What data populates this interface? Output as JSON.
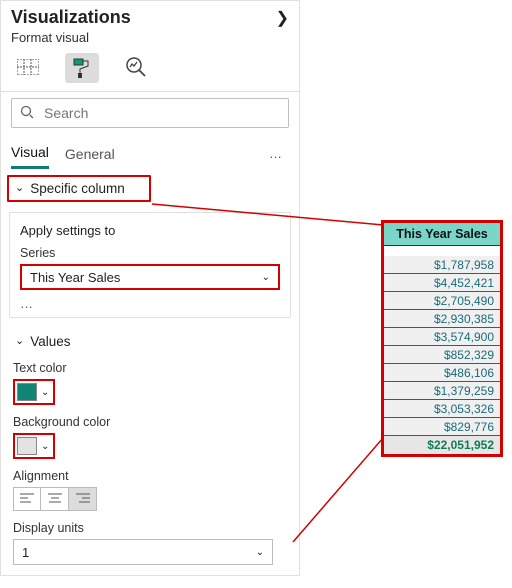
{
  "pane": {
    "title": "Visualizations",
    "subtitle": "Format visual"
  },
  "search": {
    "placeholder": "Search"
  },
  "tabs": {
    "visual": "Visual",
    "general": "General"
  },
  "specific_column": {
    "label": "Specific column"
  },
  "apply": {
    "title": "Apply settings to",
    "series_label": "Series",
    "series_value": "This Year Sales"
  },
  "values_section": {
    "title": "Values",
    "text_color_label": "Text color",
    "text_color_value": "#108678",
    "bg_color_label": "Background color",
    "bg_color_value": "#e3e3e3",
    "alignment_label": "Alignment",
    "alignment_value": "right",
    "display_units_label": "Display units",
    "display_units_value": "1"
  },
  "table": {
    "header": "This Year Sales",
    "rows": [
      "$1,787,958",
      "$4,452,421",
      "$2,705,490",
      "$2,930,385",
      "$3,574,900",
      "$852,329",
      "$486,106",
      "$1,379,259",
      "$3,053,326",
      "$829,776"
    ],
    "total": "$22,051,952"
  }
}
